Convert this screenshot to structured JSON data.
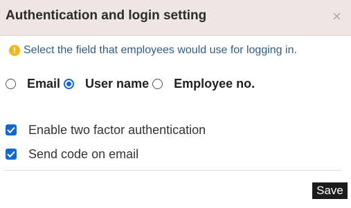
{
  "dialog": {
    "title": "Authentication and login setting",
    "close_symbol": "×"
  },
  "info": {
    "icon": "warning-circle-icon",
    "text": "Select the field that employees would use for logging in."
  },
  "login_field": {
    "options": [
      {
        "label": "Email",
        "selected": false
      },
      {
        "label": "User name",
        "selected": true
      },
      {
        "label": "Employee no.",
        "selected": false
      }
    ]
  },
  "options": {
    "two_factor": {
      "label": "Enable two factor authentication",
      "checked": true
    },
    "send_code_email": {
      "label": "Send code on email",
      "checked": true
    }
  },
  "footer": {
    "save_label": "Save"
  },
  "colors": {
    "header_bg": "#eee5e4",
    "accent": "#1366d6",
    "info_icon": "#f2b51b",
    "info_text": "#2d5e86",
    "save_bg": "#1c1c1c"
  }
}
